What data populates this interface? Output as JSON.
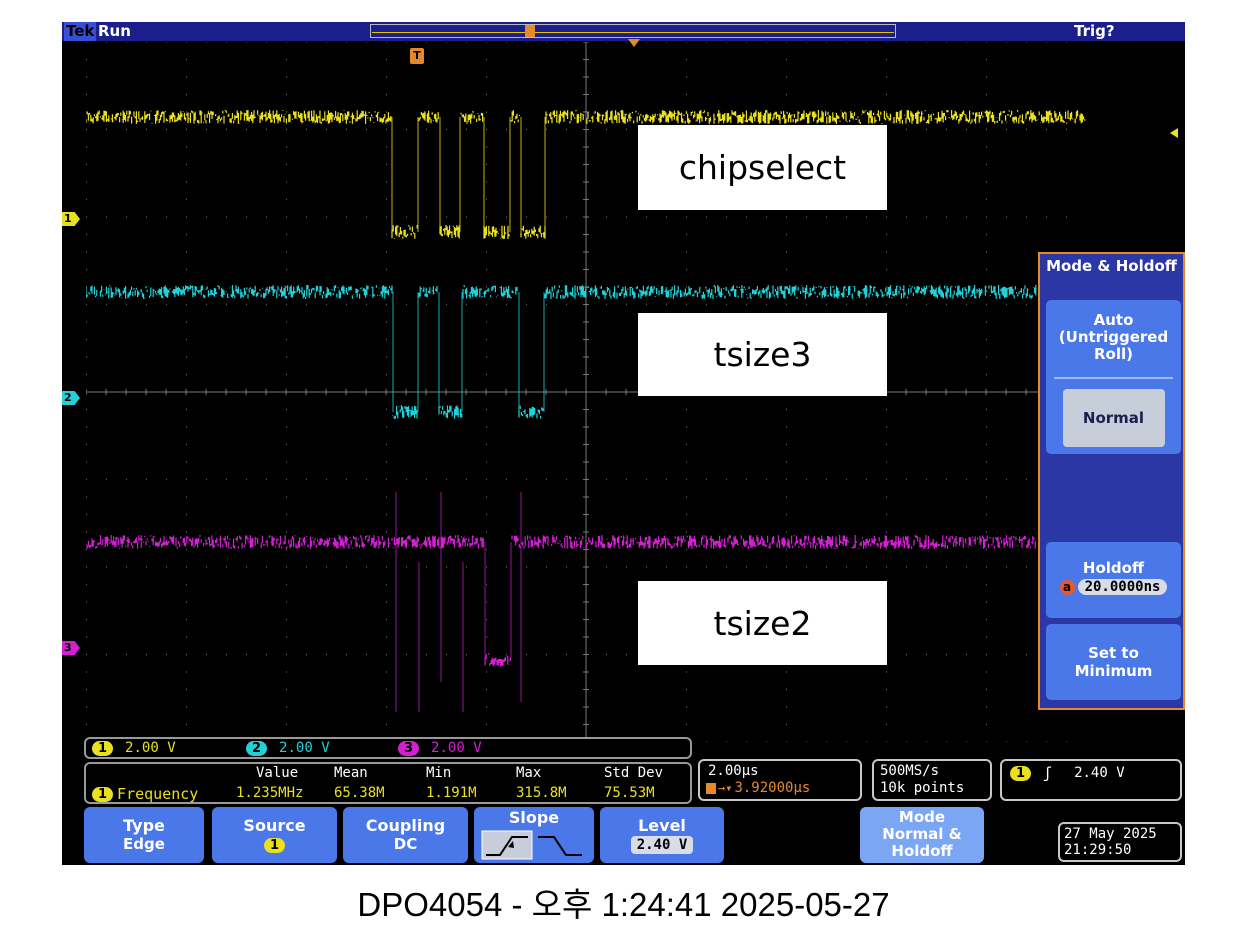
{
  "header": {
    "brand": "Tek",
    "state": "Run",
    "trigger_status": "Trig?"
  },
  "channels": [
    {
      "id": "1",
      "color": "#e8e020",
      "label": "chipselect",
      "scale": "2.00 V"
    },
    {
      "id": "2",
      "color": "#22d0d8",
      "label": "tsize3",
      "scale": "2.00 V"
    },
    {
      "id": "3",
      "color": "#d020d0",
      "label": "tsize2",
      "scale": "2.00 V"
    }
  ],
  "trigger_marker": "T",
  "menu": {
    "title": "Mode & Holdoff",
    "auto_label": "Auto (Untriggered Roll)",
    "normal_label": "Normal",
    "holdoff_label": "Holdoff",
    "holdoff_knob": "a",
    "holdoff_value": "20.0000ns",
    "set_min_label": "Set to Minimum"
  },
  "measurement": {
    "source": "1",
    "name": "Frequency",
    "headers": [
      "Value",
      "Mean",
      "Min",
      "Max",
      "Std Dev"
    ],
    "values": [
      "1.235MHz",
      "65.38M",
      "1.191M",
      "315.8M",
      "75.53M"
    ]
  },
  "timebase": {
    "scale": "2.00μs",
    "position": "3.92000μs"
  },
  "acquisition": {
    "rate": "500MS/s",
    "points": "10k points"
  },
  "trigger": {
    "source": "1",
    "slope_symbol": "ʃ",
    "level": "2.40 V"
  },
  "softkeys": {
    "type": {
      "label": "Type",
      "value": "Edge"
    },
    "source": {
      "label": "Source",
      "value": "1"
    },
    "coupling": {
      "label": "Coupling",
      "value": "DC"
    },
    "slope": {
      "label": "Slope"
    },
    "level": {
      "label": "Level",
      "value": "2.40 V"
    },
    "mode": {
      "label": "Mode",
      "value": "Normal & Holdoff"
    }
  },
  "datetime": {
    "date": "27 May 2025",
    "time": "21:29:50"
  },
  "footer": "DPO4054 - 오후 1:24:41   2025-05-27"
}
